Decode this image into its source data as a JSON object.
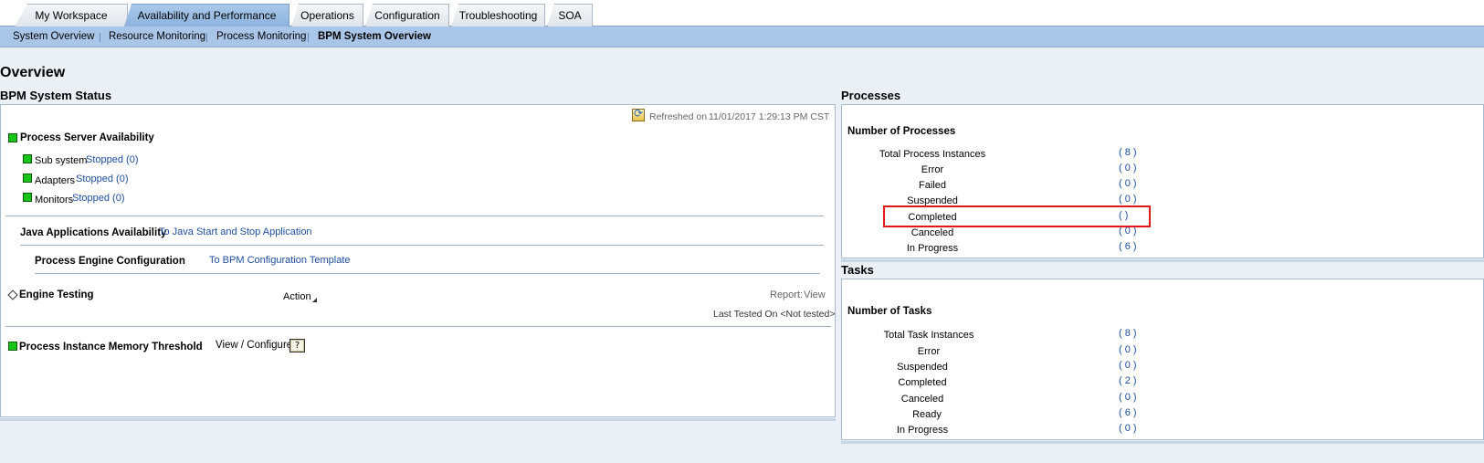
{
  "tabs": [
    {
      "label": "My Workspace"
    },
    {
      "label": "Availability and Performance"
    },
    {
      "label": "Operations"
    },
    {
      "label": "Configuration"
    },
    {
      "label": "Troubleshooting"
    },
    {
      "label": "SOA"
    }
  ],
  "subnav": [
    {
      "label": "System Overview"
    },
    {
      "label": "Resource Monitoring"
    },
    {
      "label": "Process Monitoring"
    },
    {
      "label": "BPM System Overview"
    }
  ],
  "page_title": "Overview",
  "bpm_status": {
    "title": "BPM System Status",
    "refreshed_label": "Refreshed on",
    "refreshed_time": "11/01/2017 1:29:13 PM CST",
    "process_server": "Process Server Availability",
    "sub_system_label": "Sub system",
    "sub_system_link": "Stopped (0)",
    "adapters_label": "Adapters",
    "adapters_link": "Stopped (0)",
    "monitors_label": "Monitors",
    "monitors_link": "Stopped (0)",
    "java_apps_label": "Java Applications Availability",
    "java_apps_link": "To Java Start and Stop Application",
    "pe_config_label": "Process Engine Configuration",
    "pe_config_link": "To BPM Configuration Template",
    "engine_testing_label": "Engine Testing",
    "action_label": "Action",
    "report_label": "Report:",
    "report_view": "View",
    "last_tested": "Last Tested On <Not tested>",
    "memory_threshold_label": "Process Instance Memory Threshold",
    "view_configure": "View / Configure",
    "help_glyph": "?"
  },
  "processes": {
    "title": "Processes",
    "subtitle": "Number of Processes",
    "rows": [
      {
        "label": "Total Process Instances",
        "value": "( 8 )"
      },
      {
        "label": "Error",
        "value": "( 0 )"
      },
      {
        "label": "Failed",
        "value": "( 0 )"
      },
      {
        "label": "Suspended",
        "value": "( 0 )"
      },
      {
        "label": "Completed",
        "value": "(   )"
      },
      {
        "label": "Canceled",
        "value": "( 0 )"
      },
      {
        "label": "In Progress",
        "value": "( 6 )"
      }
    ]
  },
  "tasks": {
    "title": "Tasks",
    "subtitle": "Number of Tasks",
    "rows": [
      {
        "label": "Total Task Instances",
        "value": "( 8 )"
      },
      {
        "label": "Error",
        "value": "( 0 )"
      },
      {
        "label": "Suspended",
        "value": "( 0 )"
      },
      {
        "label": "Completed",
        "value": "( 2 )"
      },
      {
        "label": "Canceled",
        "value": "( 0 )"
      },
      {
        "label": "Ready",
        "value": "( 6 )"
      },
      {
        "label": "In Progress",
        "value": "( 0 )"
      }
    ]
  }
}
